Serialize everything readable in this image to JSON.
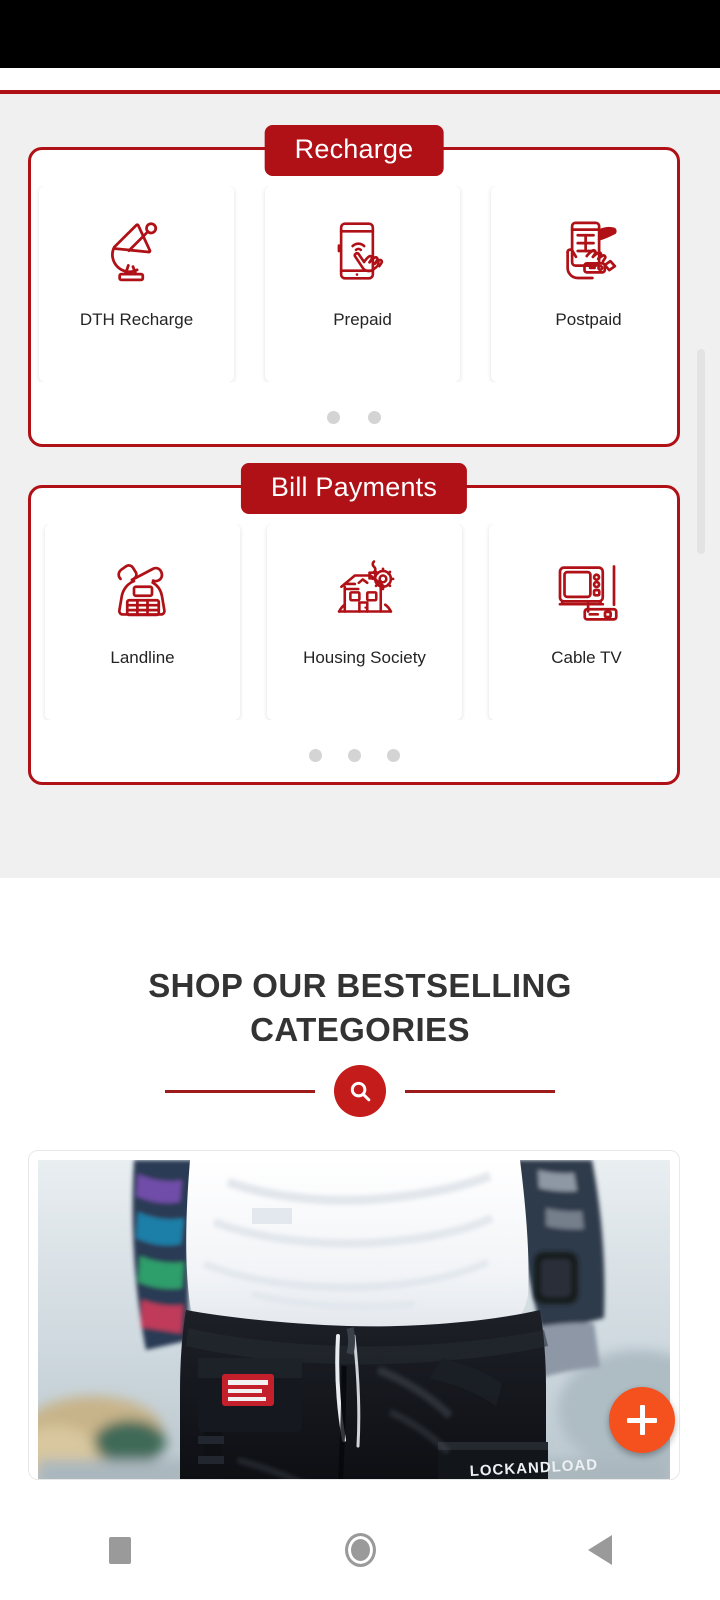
{
  "status_bar": {
    "icon": "status-bar"
  },
  "services": {
    "panels": [
      {
        "title": "Recharge",
        "tiles": [
          {
            "label": "DTH Recharge",
            "icon": "satellite-dish-icon"
          },
          {
            "label": "Prepaid",
            "icon": "phone-tap-wifi-icon"
          },
          {
            "label": "Postpaid",
            "icon": "phone-in-hand-keypad-icon"
          }
        ],
        "dots": 2,
        "active_dot": 0
      },
      {
        "title": "Bill Payments",
        "tiles": [
          {
            "label": "Landline",
            "icon": "landline-telephone-icon"
          },
          {
            "label": "Housing Society",
            "icon": "house-gear-icon"
          },
          {
            "label": "Cable TV",
            "icon": "television-settop-box-icon"
          }
        ],
        "dots": 3,
        "active_dot": 0
      }
    ],
    "scrollbar": "vertical-scrollbar"
  },
  "shop": {
    "heading_line1": "SHOP OUR BESTSELLING",
    "heading_line2": "CATEGORIES",
    "rule_icon": "search-icon",
    "product_card": {
      "image_alt": "black-cargo-pants-product-photo",
      "patch_label": "LOCKANDLOAD"
    }
  },
  "fab": {
    "icon": "plus-icon",
    "label": "+"
  },
  "nav_bar": {
    "buttons": [
      {
        "name": "recents-button",
        "icon": "square-icon"
      },
      {
        "name": "home-button",
        "icon": "circle-icon"
      },
      {
        "name": "back-button",
        "icon": "triangle-left-icon"
      }
    ]
  },
  "colors": {
    "brand_red": "#B01116",
    "accent_orange": "#F4511E",
    "panel_bg": "#F0F0F0",
    "heading_text": "#333333"
  }
}
